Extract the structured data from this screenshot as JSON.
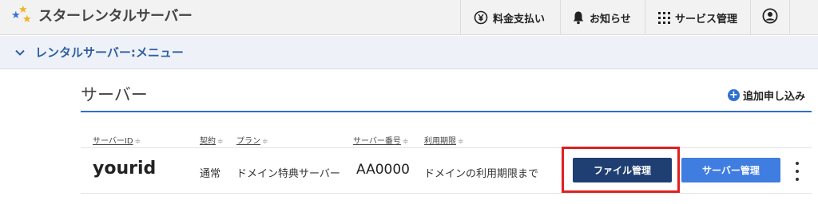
{
  "header": {
    "brand": "スターレンタルサーバー",
    "nav": {
      "payment": "料金支払い",
      "notice": "お知らせ",
      "service": "サービス管理"
    }
  },
  "submenu": {
    "label": "レンタルサーバー:メニュー"
  },
  "section": {
    "title": "サーバー",
    "add_label": "追加申し込み"
  },
  "table": {
    "columns": {
      "server_id": "サーバーID",
      "contract": "契約",
      "plan": "プラン",
      "server_number": "サーバー番号",
      "expiry": "利用期限"
    },
    "sort_glyph": "≑",
    "row": {
      "server_id": "yourid",
      "contract": "通常",
      "plan": "ドメイン特典サーバー",
      "server_number": "AA0000",
      "expiry": "ドメインの利用期限まで",
      "file_button": "ファイル管理",
      "server_button": "サーバー管理"
    }
  },
  "colors": {
    "accent": "#2f6fd1",
    "file_button": "#1f3f72",
    "server_button": "#3f7de0",
    "highlight": "#e02020"
  }
}
